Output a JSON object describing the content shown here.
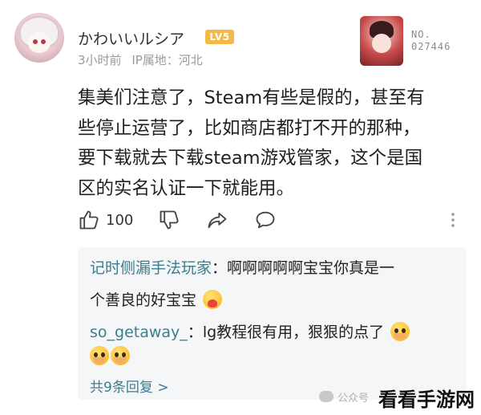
{
  "post": {
    "username": "かわいいルシア",
    "level_badge": "LV5",
    "time": "3小时前",
    "location": "IP属地：河北",
    "card_number_line1": "NO.",
    "card_number_line2": "027446",
    "content_lines": [
      "集美们注意了，Steam有些是假的，甚至有",
      "些停止运营了，比如商店都打不开的那种，",
      "要下载就去下载steam游戏管家，这个是国",
      "区的实名认证一下就能用。"
    ]
  },
  "actions": {
    "like_count": "100"
  },
  "replies": [
    {
      "name": "记时侧漏手法玩家",
      "text_part1": "啊啊啊啊啊宝宝你真是一",
      "text_part2": "个善良的好宝宝"
    },
    {
      "name": "so_getaway_",
      "text": "lg教程很有用，狠狠的点了"
    }
  ],
  "more_replies_label": "共9条回复 >",
  "watermark": {
    "text": "公众号",
    "site": "看看手游网"
  },
  "icons": [
    "thumbs-up-icon",
    "thumbs-down-icon",
    "share-icon",
    "comment-icon",
    "more-vertical-icon",
    "wechat-icon"
  ]
}
